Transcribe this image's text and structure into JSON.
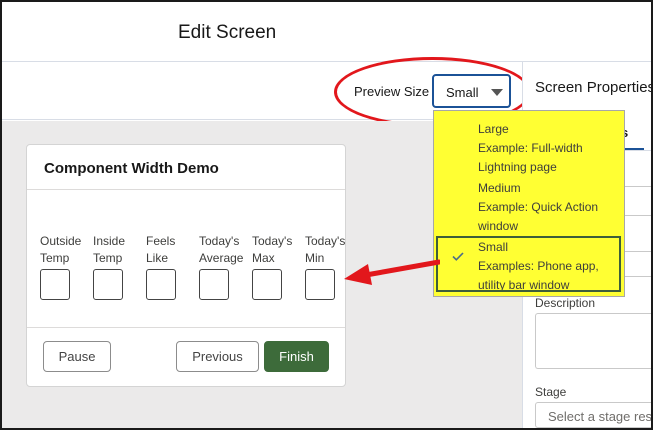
{
  "header": {
    "title": "Edit Screen"
  },
  "toolbar": {
    "preview_label": "Preview Size",
    "preview_value": "Small"
  },
  "card": {
    "title": "Component Width Demo",
    "fields": [
      {
        "label": "Outside Temp",
        "line1": "Outside",
        "line2": "Temp"
      },
      {
        "label": "Inside Temp",
        "line1": "Inside",
        "line2": "Temp"
      },
      {
        "label": "Feels Like",
        "line1": "Feels",
        "line2": "Like"
      },
      {
        "label": "Today's Average",
        "line1": "Today's",
        "line2": "Average"
      },
      {
        "label": "Today's Max",
        "line1": "Today's",
        "line2": "Max"
      },
      {
        "label": "Today's Min",
        "line1": "Today's",
        "line2": "Min"
      }
    ],
    "buttons": {
      "pause": "Pause",
      "previous": "Previous",
      "finish": "Finish"
    }
  },
  "dropdown": {
    "options": [
      {
        "title": "Large",
        "line1": "Example: Full-width",
        "line2": "Lightning page",
        "selected": false
      },
      {
        "title": "Medium",
        "line1": "Example: Quick Action",
        "line2": "window",
        "selected": false
      },
      {
        "title": "Small",
        "line1": "Examples: Phone app,",
        "line2": "utility bar window",
        "selected": true
      }
    ]
  },
  "right_panel": {
    "title": "Screen Properties",
    "tab_partial": "s",
    "description_label": "Description",
    "stage_label": "Stage",
    "stage_placeholder": "Select a stage reso"
  },
  "colors": {
    "annotation_red": "#e2171c",
    "highlight_yellow": "#ffff33",
    "brand_green": "#3d6b3a",
    "select_border_blue": "#1b5297"
  }
}
